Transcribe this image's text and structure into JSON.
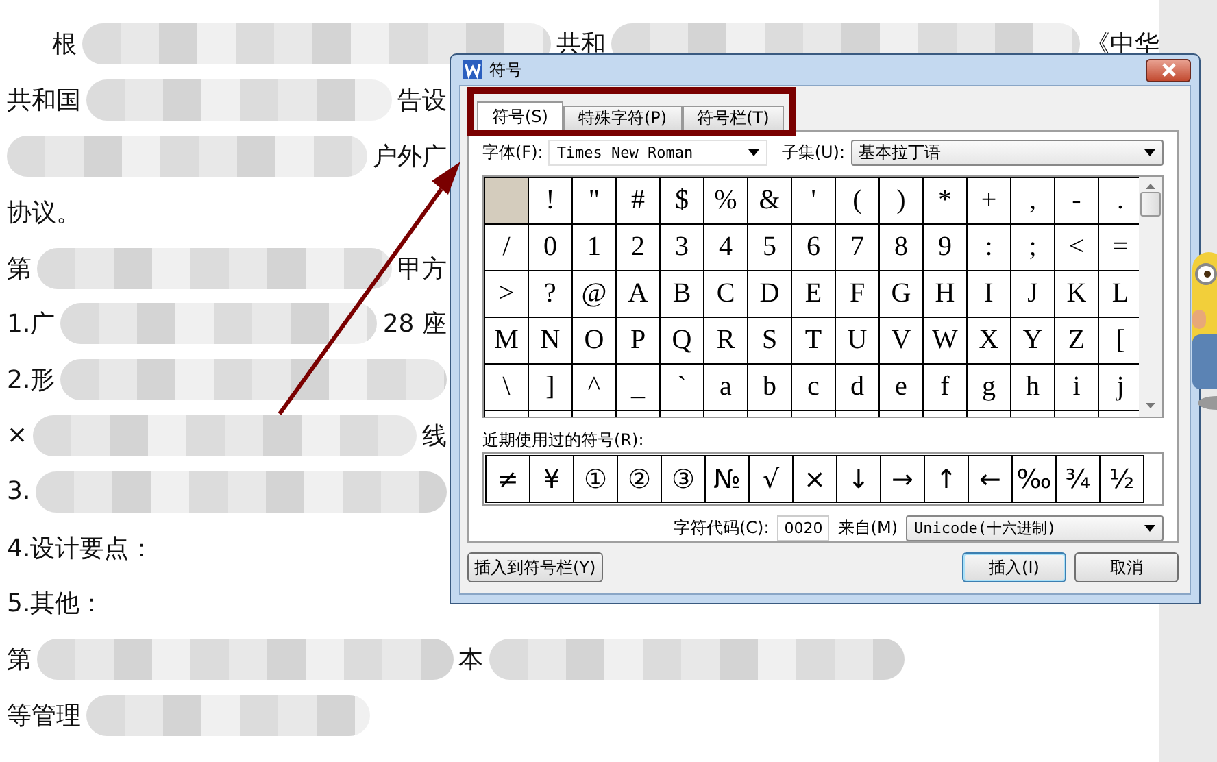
{
  "document": {
    "lines": [
      {
        "indent": true,
        "parts": [
          {
            "kind": "text",
            "text": "根"
          },
          {
            "kind": "blur"
          },
          {
            "kind": "text",
            "text": "共和"
          },
          {
            "kind": "blur"
          },
          {
            "kind": "text",
            "text": "《中华"
          }
        ]
      },
      {
        "indent": false,
        "parts": [
          {
            "kind": "text",
            "text": "共和国"
          },
          {
            "kind": "blur"
          },
          {
            "kind": "text",
            "text": "告设"
          }
        ]
      },
      {
        "indent": false,
        "parts": [
          {
            "kind": "blur"
          },
          {
            "kind": "text",
            "text": "户外广"
          }
        ]
      },
      {
        "indent": false,
        "parts": [
          {
            "kind": "text",
            "text": "协议。"
          }
        ]
      },
      {
        "indent": false,
        "parts": [
          {
            "kind": "text",
            "text": "第"
          },
          {
            "kind": "blur"
          },
          {
            "kind": "text",
            "text": "甲方"
          }
        ]
      },
      {
        "indent": false,
        "parts": [
          {
            "kind": "text",
            "text": "1.广"
          },
          {
            "kind": "blur"
          },
          {
            "kind": "text",
            "text": "28 座"
          }
        ]
      },
      {
        "indent": false,
        "parts": [
          {
            "kind": "text",
            "text": "2.形"
          },
          {
            "kind": "blur"
          }
        ]
      },
      {
        "indent": false,
        "parts": [
          {
            "kind": "text",
            "text": "×"
          },
          {
            "kind": "blur"
          },
          {
            "kind": "text",
            "text": "线"
          }
        ]
      },
      {
        "indent": false,
        "parts": [
          {
            "kind": "text",
            "text": "3."
          },
          {
            "kind": "blur"
          }
        ]
      },
      {
        "indent": false,
        "parts": [
          {
            "kind": "text",
            "text": "4.设计要点："
          }
        ]
      },
      {
        "indent": false,
        "parts": [
          {
            "kind": "text",
            "text": "5.其他："
          }
        ]
      },
      {
        "indent": false,
        "parts": [
          {
            "kind": "text",
            "text": "第"
          },
          {
            "kind": "blur"
          },
          {
            "kind": "text",
            "text": "本"
          },
          {
            "kind": "blur"
          }
        ]
      },
      {
        "indent": false,
        "parts": [
          {
            "kind": "text",
            "text": "等管理"
          },
          {
            "kind": "blur"
          }
        ]
      }
    ]
  },
  "dialog": {
    "title": "符号",
    "tabs": [
      {
        "label": "符号(S)",
        "selected": true
      },
      {
        "label": "特殊字符(P)",
        "selected": false
      },
      {
        "label": "符号栏(T)",
        "selected": false
      }
    ],
    "font_label": "字体(F):",
    "font_value": "Times New Roman",
    "subset_label": "子集(U):",
    "subset_value": "基本拉丁语",
    "cells": [
      {
        "selected": true
      },
      {
        "char": "!",
        "selected": false
      },
      {
        "char": "\"",
        "selected": false
      },
      {
        "char": "#",
        "selected": false
      },
      {
        "char": "$",
        "selected": false
      },
      {
        "char": "%",
        "selected": false
      },
      {
        "char": "&",
        "selected": false
      },
      {
        "char": "'",
        "selected": false
      },
      {
        "char": "(",
        "selected": false
      },
      {
        "char": ")",
        "selected": false
      },
      {
        "char": "*",
        "selected": false
      },
      {
        "char": "+",
        "selected": false
      },
      {
        "char": ",",
        "selected": false
      },
      {
        "char": "-",
        "selected": false
      },
      {
        "char": ".",
        "selected": false
      },
      {
        "char": "/",
        "selected": false
      },
      {
        "char": "0",
        "selected": false
      },
      {
        "char": "1",
        "selected": false
      },
      {
        "char": "2",
        "selected": false
      },
      {
        "char": "3",
        "selected": false
      },
      {
        "char": "4",
        "selected": false
      },
      {
        "char": "5",
        "selected": false
      },
      {
        "char": "6",
        "selected": false
      },
      {
        "char": "7",
        "selected": false
      },
      {
        "char": "8",
        "selected": false
      },
      {
        "char": "9",
        "selected": false
      },
      {
        "char": ":",
        "selected": false
      },
      {
        "char": ";",
        "selected": false
      },
      {
        "char": "<",
        "selected": false
      },
      {
        "char": "=",
        "selected": false
      },
      {
        "char": ">",
        "selected": false
      },
      {
        "char": "?",
        "selected": false
      },
      {
        "char": "@",
        "selected": false
      },
      {
        "char": "A",
        "selected": false
      },
      {
        "char": "B",
        "selected": false
      },
      {
        "char": "C",
        "selected": false
      },
      {
        "char": "D",
        "selected": false
      },
      {
        "char": "E",
        "selected": false
      },
      {
        "char": "F",
        "selected": false
      },
      {
        "char": "G",
        "selected": false
      },
      {
        "char": "H",
        "selected": false
      },
      {
        "char": "I",
        "selected": false
      },
      {
        "char": "J",
        "selected": false
      },
      {
        "char": "K",
        "selected": false
      },
      {
        "char": "L",
        "selected": false
      },
      {
        "char": "M",
        "selected": false
      },
      {
        "char": "N",
        "selected": false
      },
      {
        "char": "O",
        "selected": false
      },
      {
        "char": "P",
        "selected": false
      },
      {
        "char": "Q",
        "selected": false
      },
      {
        "char": "R",
        "selected": false
      },
      {
        "char": "S",
        "selected": false
      },
      {
        "char": "T",
        "selected": false
      },
      {
        "char": "U",
        "selected": false
      },
      {
        "char": "V",
        "selected": false
      },
      {
        "char": "W",
        "selected": false
      },
      {
        "char": "X",
        "selected": false
      },
      {
        "char": "Y",
        "selected": false
      },
      {
        "char": "Z",
        "selected": false
      },
      {
        "char": "[",
        "selected": false
      },
      {
        "char": "\\",
        "selected": false
      },
      {
        "char": "]",
        "selected": false
      },
      {
        "char": "^",
        "selected": false
      },
      {
        "char": "_",
        "selected": false
      },
      {
        "char": "`",
        "selected": false
      },
      {
        "char": "a",
        "selected": false
      },
      {
        "char": "b",
        "selected": false
      },
      {
        "char": "c",
        "selected": false
      },
      {
        "char": "d",
        "selected": false
      },
      {
        "char": "e",
        "selected": false
      },
      {
        "char": "f",
        "selected": false
      },
      {
        "char": "g",
        "selected": false
      },
      {
        "char": "h",
        "selected": false
      },
      {
        "char": "i",
        "selected": false
      },
      {
        "char": "j",
        "selected": false
      }
    ],
    "recent_label": "近期使用过的符号(R):",
    "recent": [
      "≠",
      "¥",
      "①",
      "②",
      "③",
      "№",
      "√",
      "×",
      "↓",
      "→",
      "↑",
      "←",
      "‰",
      "¾",
      "½"
    ],
    "code_label": "字符代码(C):",
    "code_value": "0020",
    "from_label": "来自(M)",
    "from_value": "Unicode(十六进制)",
    "buttons": [
      {
        "label": "插入到符号栏(Y)",
        "kind": "left"
      },
      {
        "label": "插入(I)",
        "kind": "default"
      },
      {
        "label": "取消",
        "kind": "normal"
      }
    ]
  }
}
